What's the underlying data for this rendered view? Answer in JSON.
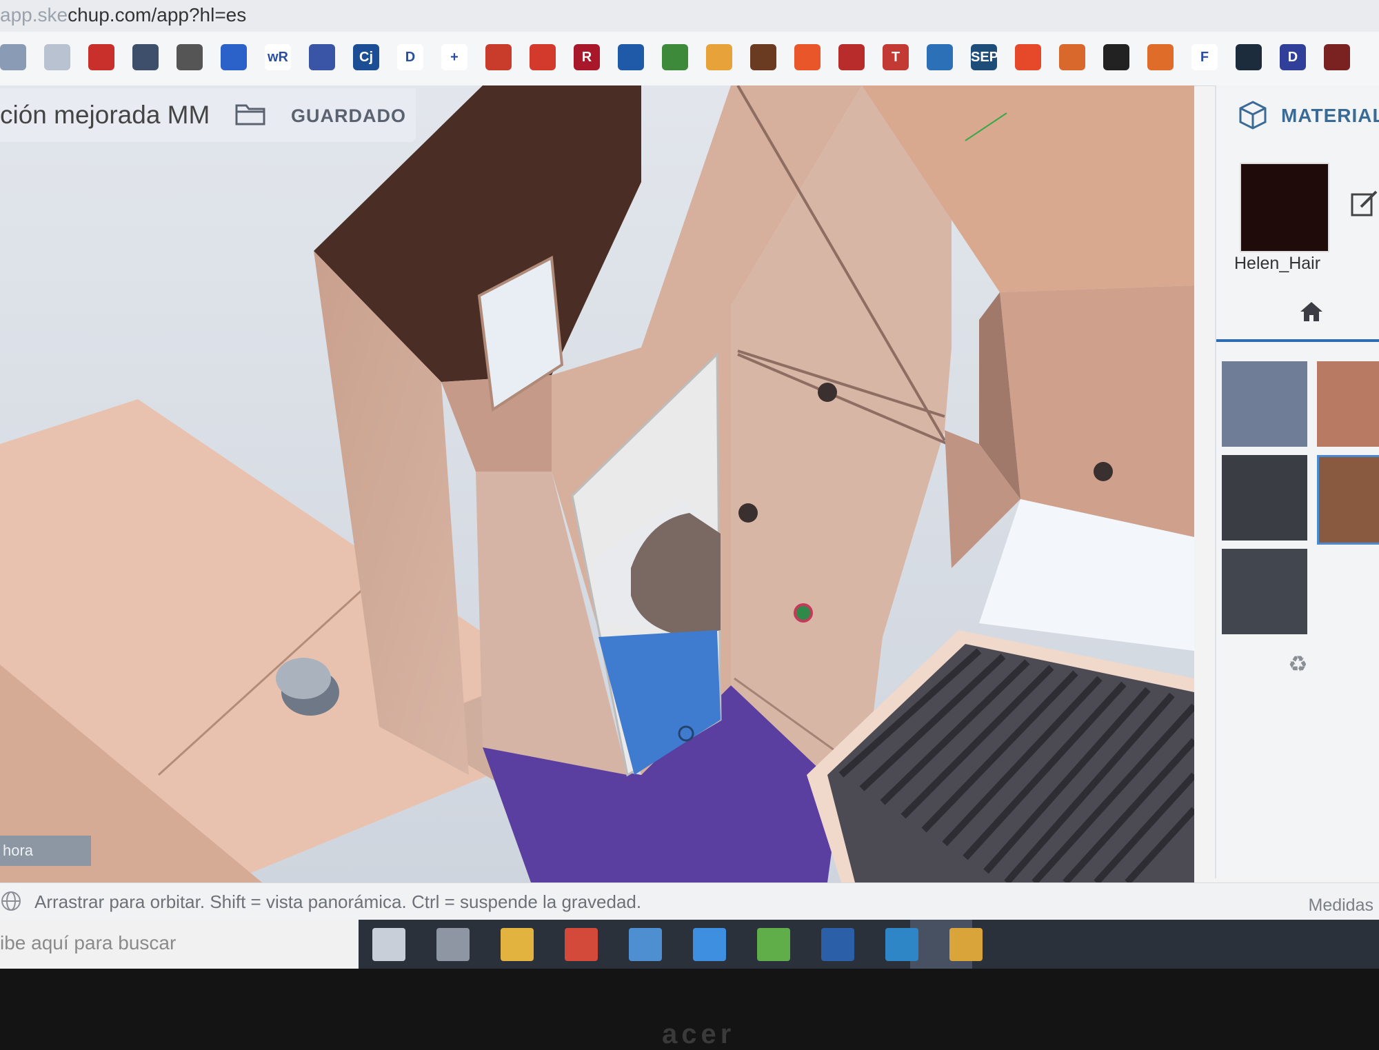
{
  "browser": {
    "url_prefix": "app.ske",
    "url_rest": "chup.com/app?hl=es",
    "bookmark_icons": [
      {
        "name": "bookmark-1-icon",
        "color": "#8a9bb5",
        "text": ""
      },
      {
        "name": "bookmark-2-icon",
        "color": "#b8c2d0",
        "text": ""
      },
      {
        "name": "bookmark-3-icon",
        "color": "#c9302c",
        "text": ""
      },
      {
        "name": "bookmark-4-icon",
        "color": "#3d4f6b",
        "text": ""
      },
      {
        "name": "bookmark-5-icon",
        "color": "#555555",
        "text": ""
      },
      {
        "name": "bookmark-6-icon",
        "color": "#2a62c9",
        "text": ""
      },
      {
        "name": "bookmark-7-icon",
        "color": "#ffffff",
        "text": "wR"
      },
      {
        "name": "bookmark-8-icon",
        "color": "#3a55a5",
        "text": ""
      },
      {
        "name": "bookmark-9-icon",
        "color": "#1b4e95",
        "text": "Cj"
      },
      {
        "name": "bookmark-10-icon",
        "color": "#ffffff",
        "text": "D"
      },
      {
        "name": "bookmark-11-icon",
        "color": "#ffffff",
        "text": "+"
      },
      {
        "name": "bookmark-12-icon",
        "color": "#c93b2b",
        "text": ""
      },
      {
        "name": "bookmark-13-icon",
        "color": "#d33a2c",
        "text": ""
      },
      {
        "name": "bookmark-14-icon",
        "color": "#a9182a",
        "text": "R"
      },
      {
        "name": "bookmark-15-icon",
        "color": "#1e5aa8",
        "text": ""
      },
      {
        "name": "bookmark-16-icon",
        "color": "#3c8a3a",
        "text": ""
      },
      {
        "name": "bookmark-17-icon",
        "color": "#e8a23a",
        "text": ""
      },
      {
        "name": "bookmark-18-icon",
        "color": "#6a3b20",
        "text": ""
      },
      {
        "name": "bookmark-19-icon",
        "color": "#e8562a",
        "text": ""
      },
      {
        "name": "bookmark-20-icon",
        "color": "#b82c2c",
        "text": ""
      },
      {
        "name": "bookmark-21-icon",
        "color": "#c23a33",
        "text": "T"
      },
      {
        "name": "bookmark-22-icon",
        "color": "#2c70b8",
        "text": ""
      },
      {
        "name": "bookmark-23-icon",
        "color": "#1d4d78",
        "text": "SEP"
      },
      {
        "name": "bookmark-24-icon",
        "color": "#e5492a",
        "text": ""
      },
      {
        "name": "bookmark-25-icon",
        "color": "#d8682c",
        "text": ""
      },
      {
        "name": "bookmark-26-icon",
        "color": "#222222",
        "text": ""
      },
      {
        "name": "bookmark-27-icon",
        "color": "#e06c2a",
        "text": ""
      },
      {
        "name": "bookmark-28-icon",
        "color": "#ffffff",
        "text": "F"
      },
      {
        "name": "bookmark-29-icon",
        "color": "#1c2c3c",
        "text": ""
      },
      {
        "name": "bookmark-30-icon",
        "color": "#2f3f9a",
        "text": "D"
      },
      {
        "name": "bookmark-31-icon",
        "color": "#7a2222",
        "text": ""
      }
    ]
  },
  "app": {
    "model_name": "ción mejorada MM",
    "saved_label": "GUARDADO"
  },
  "materials_panel": {
    "title": "MATERIALE",
    "selected_material": "Helen_Hair",
    "selected_color": "#1f0c0a",
    "swatches": [
      "#6f7e96",
      "#b97a63",
      "#3a3d44",
      "#8a5a40",
      "#42464e"
    ]
  },
  "status": {
    "hint": "Arrastrar para orbitar. Shift = vista panorámica. Ctrl = suspende la gravedad.",
    "measures_label": "Medidas",
    "left_tag": "hora"
  },
  "taskbar": {
    "search_placeholder": "ibe aquí para buscar",
    "apps": [
      {
        "name": "task-view-icon",
        "color": "#c9cfd8"
      },
      {
        "name": "calculator-icon",
        "color": "#8d96a2"
      },
      {
        "name": "file-explorer-icon",
        "color": "#e2b33f"
      },
      {
        "name": "chrome-icon",
        "color": "#d44a3a"
      },
      {
        "name": "edge-icon",
        "color": "#4d8fd1"
      },
      {
        "name": "dropbox-icon",
        "color": "#3e8fe0"
      },
      {
        "name": "spreadsheet-app-icon",
        "color": "#5fae4a"
      },
      {
        "name": "photoshop-icon",
        "color": "#2b5fa8"
      },
      {
        "name": "network-app-icon",
        "color": "#2f86c6"
      },
      {
        "name": "sketchup-icon",
        "color": "#d9a43a"
      }
    ]
  },
  "colors": {
    "wood_light": "#e7b9a2",
    "wood_mid": "#c89a84",
    "wood_dark": "#6a4436",
    "floor_purple": "#5b3fa0",
    "shower_blue": "#3f7ccf",
    "accent_blue": "#2f6bb0"
  }
}
